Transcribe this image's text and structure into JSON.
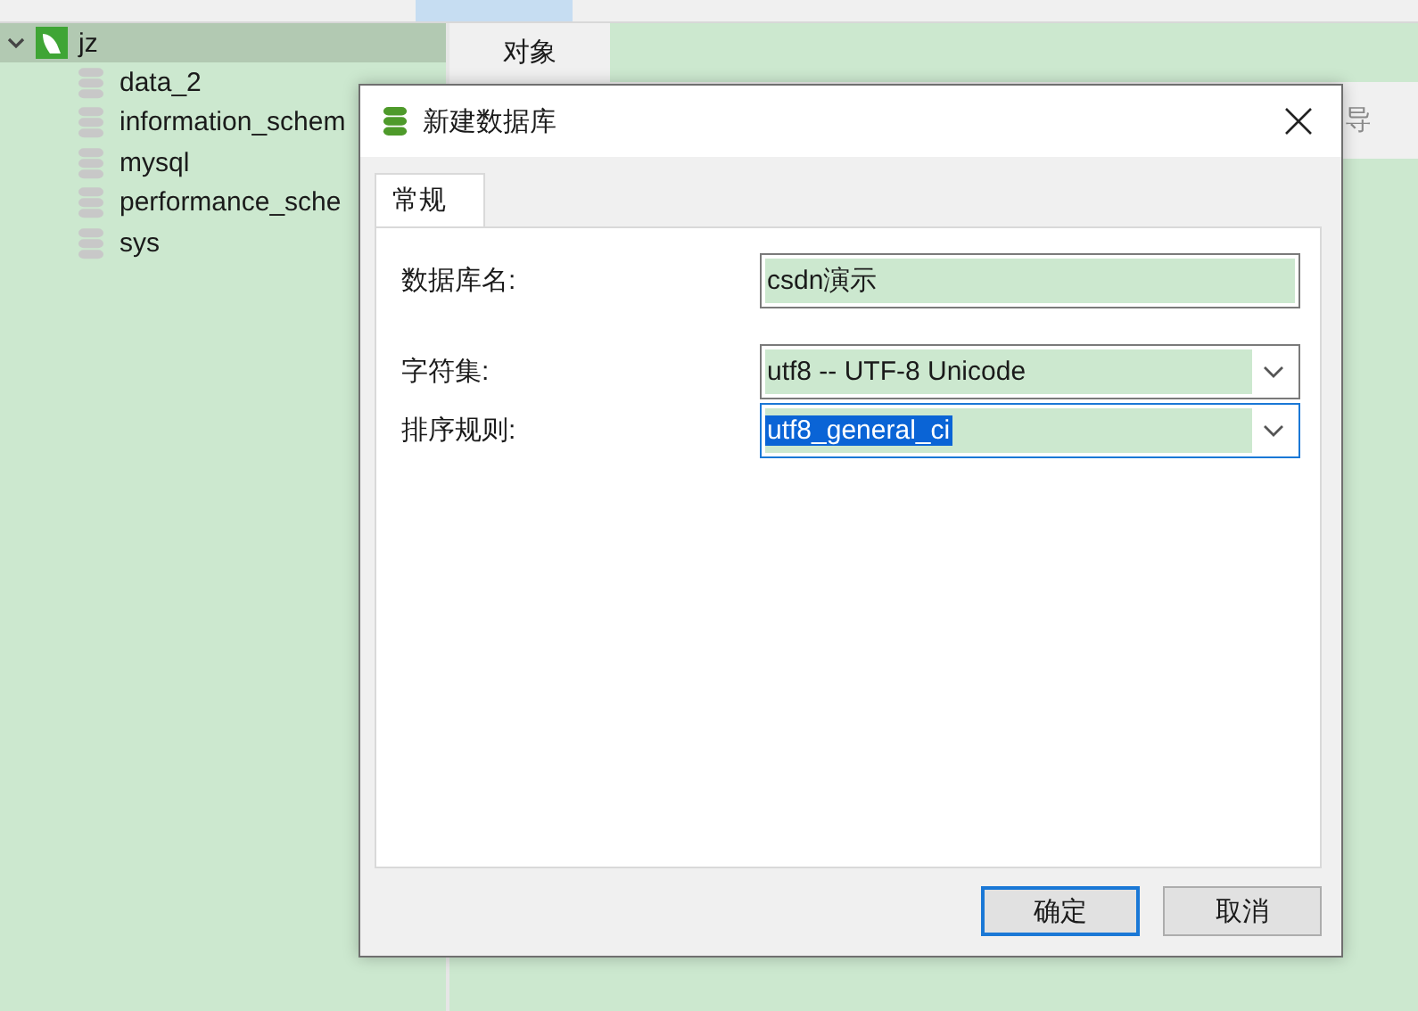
{
  "tree": {
    "connection": {
      "label": "jz",
      "expanded": true
    },
    "databases": [
      {
        "label": "data_2"
      },
      {
        "label": "information_schem"
      },
      {
        "label": "mysql"
      },
      {
        "label": "performance_sche"
      },
      {
        "label": "sys"
      }
    ]
  },
  "object_tabs": [
    {
      "label": "对象",
      "selected": true
    }
  ],
  "toolbar": {
    "label_cut": "导"
  },
  "dialog": {
    "title": "新建数据库",
    "tabs": [
      {
        "label": "常规",
        "selected": true
      }
    ],
    "fields": [
      {
        "kind": "text",
        "label": "数据库名:",
        "value": "csdn演示",
        "focused": false,
        "selected_text": false
      },
      {
        "kind": "select",
        "label": "字符集:",
        "value": "utf8 -- UTF-8 Unicode",
        "focused": false,
        "selected_text": false
      },
      {
        "kind": "select",
        "label": "排序规则:",
        "value": "utf8_general_ci",
        "focused": true,
        "selected_text": true
      }
    ],
    "buttons": [
      {
        "label": "确定",
        "default": true
      },
      {
        "label": "取消",
        "default": false
      }
    ]
  }
}
